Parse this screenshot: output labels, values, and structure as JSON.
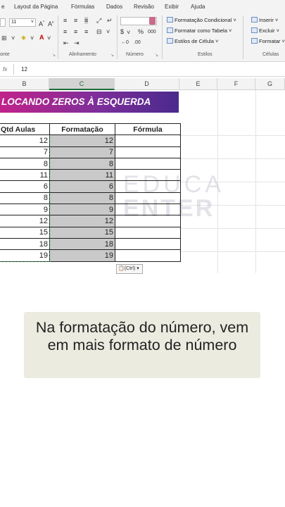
{
  "menu": [
    "e",
    "Layout da Página",
    "Fórmulas",
    "Dados",
    "Revisão",
    "Exibir",
    "Ajuda"
  ],
  "ribbon": {
    "font_size": "11",
    "groups": {
      "fonte": "onte",
      "alinhamento": "Alinhamento",
      "numero": "Número",
      "estilos": "Estilos",
      "celulas": "Células"
    },
    "number_symbols": {
      "percent": "%",
      "comma": "000"
    },
    "styles": [
      "Formatação Condicional ˅",
      "Formatar como Tabela ˅",
      "Estilos de Célula ˅"
    ],
    "cells": [
      "Inserir ˅",
      "Excluir ˅",
      "Formatar ˅"
    ]
  },
  "formula_bar": {
    "fx": "fx",
    "value": "12"
  },
  "columns": [
    "B",
    "C",
    "D",
    "E",
    "F",
    "G"
  ],
  "sheet": {
    "banner": "LOCANDO ZEROS À ESQUERDA",
    "headers": {
      "b": "Qtd Aulas",
      "c": "Formatação",
      "d": "Fórmula"
    },
    "rows": [
      {
        "b": "12",
        "c": "12"
      },
      {
        "b": "7",
        "c": "7"
      },
      {
        "b": "8",
        "c": "8"
      },
      {
        "b": "11",
        "c": "11"
      },
      {
        "b": "6",
        "c": "6"
      },
      {
        "b": "8",
        "c": "8"
      },
      {
        "b": "9",
        "c": "9"
      },
      {
        "b": "12",
        "c": "12"
      },
      {
        "b": "15",
        "c": "15"
      },
      {
        "b": "18",
        "c": "18"
      },
      {
        "b": "19",
        "c": "19"
      }
    ],
    "paste_options": "(Ctrl) ▾"
  },
  "watermark": {
    "line1": "EDUCA",
    "line2": "ENTER"
  },
  "caption": "Na formatação do número, vem em mais formato de número",
  "colors": {
    "banner_start": "#c0238a",
    "banner_end": "#4a2a8c",
    "excel_green": "#1e6b3a",
    "selection": "#c9c9c9"
  }
}
